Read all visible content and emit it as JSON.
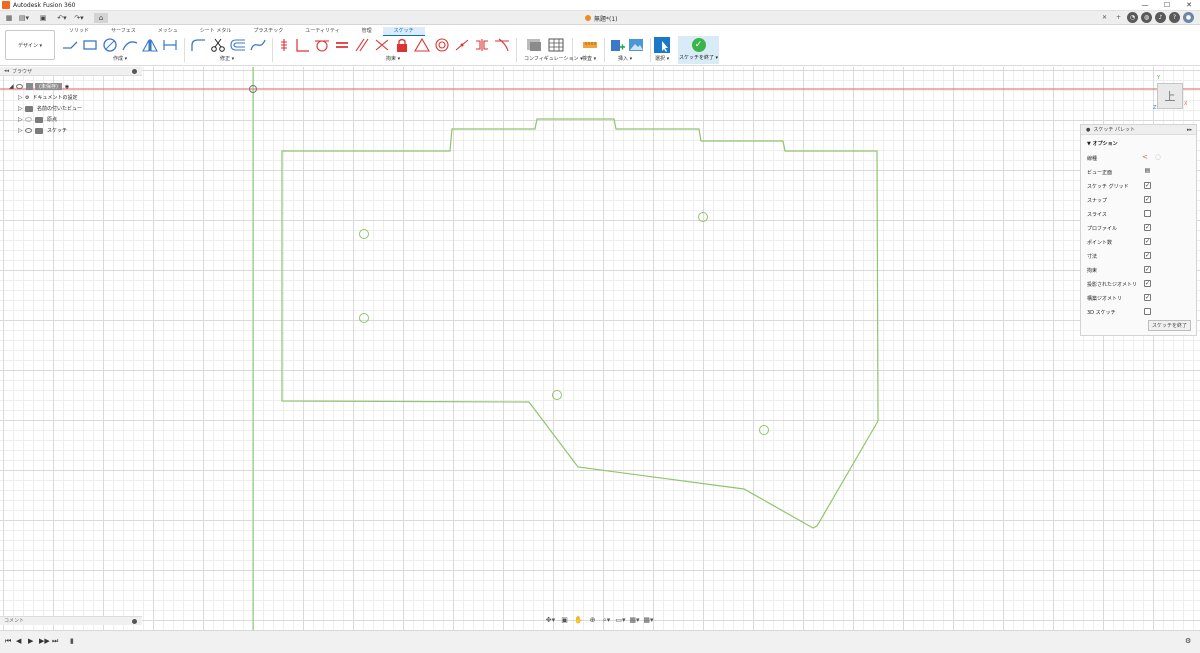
{
  "app": {
    "title": "Autodesk Fusion 360",
    "document_tab": "無題*(1)"
  },
  "window_controls": {
    "minimize": "—",
    "maximize": "☐",
    "close": "✕"
  },
  "quick_access": {
    "close_tab": "✕",
    "new_tab": "+"
  },
  "ribbon": {
    "workspace": "デザイン ▾",
    "tabs": [
      "ソリッド",
      "サーフェス",
      "メッシュ",
      "シート メタル",
      "プラスチック",
      "ユーティリティ",
      "管理",
      "スケッチ"
    ],
    "active_tab": "スケッチ",
    "groups": {
      "create": "作成 ▾",
      "modify": "修正 ▾",
      "constraints": "拘束 ▾",
      "configure": "コンフィギュレーション ▾",
      "inspect": "検査 ▾",
      "insert": "挿入 ▾",
      "select": "選択 ▾",
      "finish": "スケッチを終了 ▾"
    }
  },
  "browser": {
    "title": "ブラウザ",
    "root": "(未保存)",
    "items": [
      "ドキュメントの設定",
      "名前の付いたビュー",
      "原点",
      "スケッチ"
    ]
  },
  "comments": {
    "title": "コメント"
  },
  "sketch_palette": {
    "title": "スケッチ パレット",
    "section": "オプション",
    "rows": [
      {
        "label": "線種",
        "checked": null
      },
      {
        "label": "ビュー正面",
        "checked": null
      },
      {
        "label": "スケッチ グリッド",
        "checked": true
      },
      {
        "label": "スナップ",
        "checked": true
      },
      {
        "label": "スライス",
        "checked": false
      },
      {
        "label": "プロファイル",
        "checked": true
      },
      {
        "label": "ポイント数",
        "checked": true
      },
      {
        "label": "寸法",
        "checked": true
      },
      {
        "label": "拘束",
        "checked": true
      },
      {
        "label": "投影されたジオメトリ",
        "checked": true
      },
      {
        "label": "構築ジオメトリ",
        "checked": true
      },
      {
        "label": "3D スケッチ",
        "checked": false
      }
    ],
    "finish_button": "スケッチを終了"
  },
  "viewcube": {
    "face": "上",
    "axis_x": "X",
    "axis_y": "Y",
    "axis_z": "Z"
  },
  "colors": {
    "sketch_line": "#8fc56b",
    "accent": "#0a6fbd",
    "finish": "#3ab54a",
    "x_axis": "#e06060",
    "y_axis": "#7ccf6a"
  }
}
